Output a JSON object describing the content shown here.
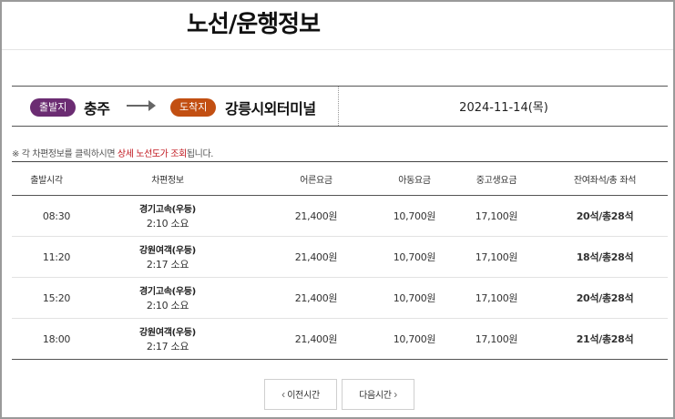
{
  "page": {
    "title": "노선/운행정보"
  },
  "route": {
    "departure_badge": "출발지",
    "departure": "충주",
    "arrival_badge": "도착지",
    "arrival": "강릉시외터미널",
    "date": "2024-11-14(목)",
    "colors": {
      "departure_badge": "#6b2c72",
      "arrival_badge": "#c24f12"
    }
  },
  "notice": {
    "prefix": "※ 각 차편정보를 클릭하시면 ",
    "highlight": "상세 노선도가 조회",
    "suffix": "됩니다.",
    "highlight_color": "#c0141c"
  },
  "table": {
    "headers": [
      "출발시각",
      "차편정보",
      "어른요금",
      "아동요금",
      "중고생요금",
      "잔여좌석/총 좌석"
    ],
    "rows": [
      {
        "time": "08:30",
        "company": "경기고속(우등)",
        "duration": "2:10 소요",
        "adult": "21,400원",
        "child": "10,700원",
        "student": "17,100원",
        "seats": "20석/총28석"
      },
      {
        "time": "11:20",
        "company": "강원여객(우등)",
        "duration": "2:17 소요",
        "adult": "21,400원",
        "child": "10,700원",
        "student": "17,100원",
        "seats": "18석/총28석"
      },
      {
        "time": "15:20",
        "company": "경기고속(우등)",
        "duration": "2:10 소요",
        "adult": "21,400원",
        "child": "10,700원",
        "student": "17,100원",
        "seats": "20석/총28석"
      },
      {
        "time": "18:00",
        "company": "강원여객(우등)",
        "duration": "2:17 소요",
        "adult": "21,400원",
        "child": "10,700원",
        "student": "17,100원",
        "seats": "21석/총28석"
      }
    ]
  },
  "pagination": {
    "prev_label": "이전시간",
    "next_label": "다음시간"
  }
}
